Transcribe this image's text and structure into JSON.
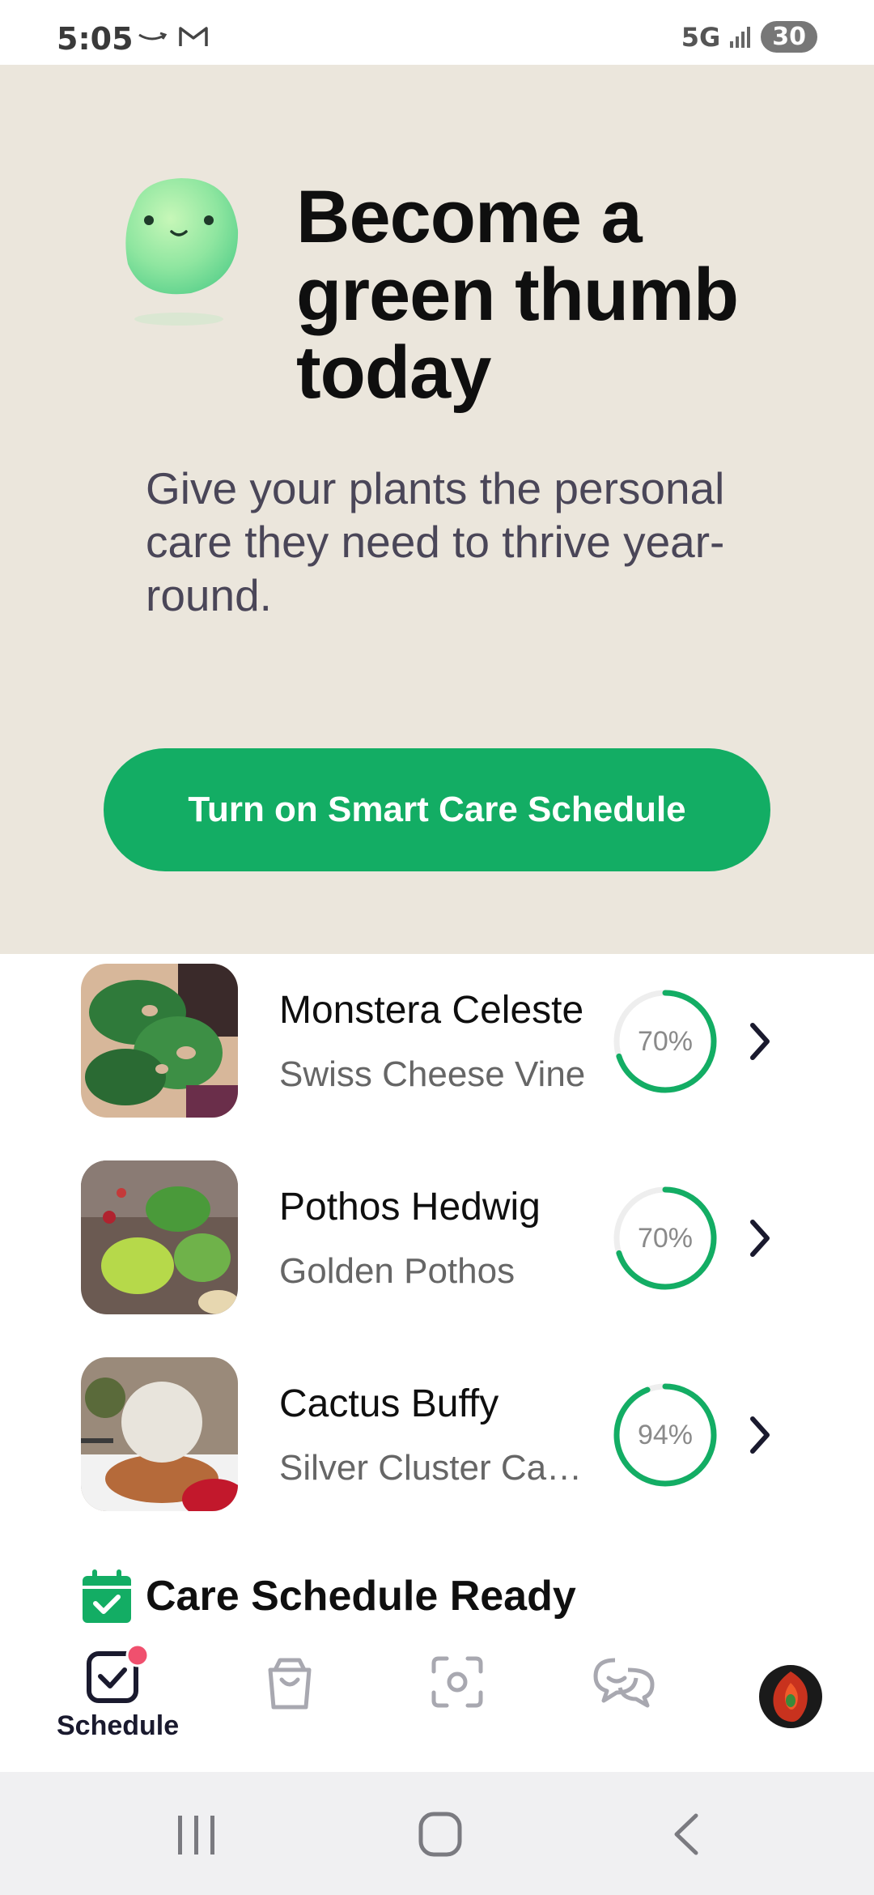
{
  "status_bar": {
    "time": "5:05",
    "network": "5G",
    "battery": "30",
    "icons": [
      "amazon-icon",
      "gmail-icon",
      "signal-icon",
      "battery-icon"
    ]
  },
  "hero": {
    "title": "Become a green thumb today",
    "subtitle": "Give your plants the personal care they need to thrive year-round.",
    "cta_label": "Turn on Smart Care Schedule",
    "background": "#ebe6dc",
    "accent": "#13ad64"
  },
  "plants": [
    {
      "name": "Monstera Celeste",
      "species": "Swiss Cheese Vine",
      "progress_label": "70%",
      "progress": 0.7
    },
    {
      "name": "Pothos Hedwig",
      "species": "Golden Pothos",
      "progress_label": "70%",
      "progress": 0.7
    },
    {
      "name": "Cactus Buffy",
      "species": "Silver Cluster Ca…",
      "progress_label": "94%",
      "progress": 0.94
    }
  ],
  "care_section": {
    "title": "Care Schedule Ready",
    "icon": "calendar-check-icon"
  },
  "bottom_nav": {
    "items": [
      {
        "label": "Schedule",
        "icon": "schedule-check-icon",
        "active": true,
        "badge": true
      },
      {
        "label": "",
        "icon": "shopping-bag-icon"
      },
      {
        "label": "",
        "icon": "scan-icon"
      },
      {
        "label": "",
        "icon": "chat-icon"
      },
      {
        "label": "",
        "icon": "avatar"
      }
    ]
  },
  "system_nav": {
    "icons": [
      "recent-apps-icon",
      "home-icon",
      "back-icon"
    ]
  }
}
